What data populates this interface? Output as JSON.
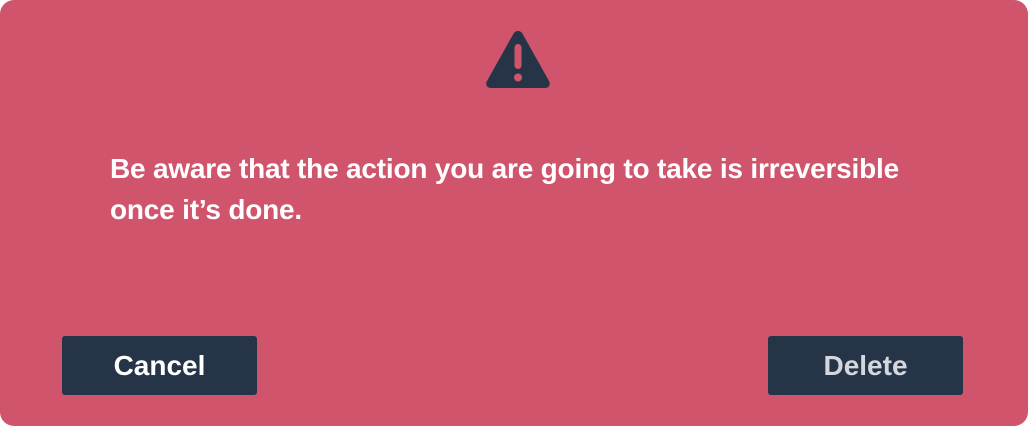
{
  "dialog": {
    "icon": "warning-triangle-icon",
    "message_line1": "Be aware that the action you are going to take is irreversible",
    "message_line2": "once it’s done.",
    "cancel_label": "Cancel",
    "delete_label": "Delete"
  },
  "colors": {
    "background": "#cf546c",
    "button": "#253447",
    "icon": "#253447",
    "text": "#ffffff",
    "delete_text": "#d4d8de"
  }
}
